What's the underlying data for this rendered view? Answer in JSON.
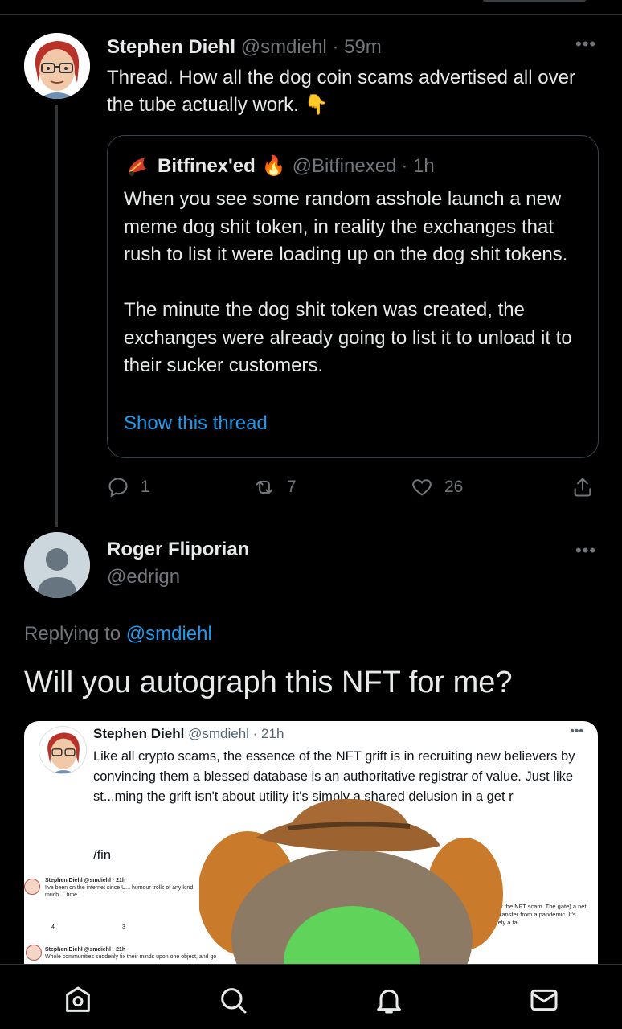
{
  "tweet1": {
    "name": "Stephen Diehl",
    "handle": "@smdiehl",
    "time": "· 59m",
    "text": "Thread. How all the dog coin scams advertised all over the tube actually work. 👇",
    "more_icon": "more-horizontal-icon"
  },
  "quote": {
    "name": "Bitfinex'ed",
    "badge": "🔥",
    "handle": "@Bitfinexed",
    "time": "· 1h",
    "text": "When you see some random asshole launch a new meme dog shit token, in reality the exchanges that rush to list it were loading up on the dog shit tokens.\n\nThe minute the dog shit token was created, the exchanges were already going to list it to unload it to their sucker customers.",
    "show_thread": "Show this thread"
  },
  "actions": {
    "replies": "1",
    "retweets": "7",
    "likes": "26"
  },
  "tweet2": {
    "name": "Roger Fliporian",
    "handle": "@edrign",
    "replying_prefix": "Replying to",
    "replying_mention": "@smdiehl",
    "text": "Will you autograph this NFT for me?"
  },
  "media": {
    "name": "Stephen Diehl",
    "handle": "@smdiehl · 21h",
    "text": "Like all crypto scams, the essence of the NFT grift is in recruiting new believers by convincing them a blessed database is an authoritative registrar of value. Just like st...ming the grift isn't about utility it's simply a shared delusion in a get r",
    "fin": "/fin",
    "mini1_header": "Stephen Diehl @smdiehl · 21h",
    "mini1_text": "I've been on the internet since U... humour trolls of any kind, much ... time.",
    "mini1_replies": "4",
    "mini1_retweets": "3",
    "mini2_header": "Stephen Diehl @smdiehl · 21h",
    "mini2_text": "Whole communities suddenly fix their minds upon one object, and go",
    "right_text": "nature of the NFT scam. The gate) a net wealth transfer from a pandemic. It's effectively a ta"
  },
  "nav": {
    "items": [
      "home-icon",
      "search-icon",
      "notifications-icon",
      "messages-icon"
    ]
  },
  "colors": {
    "background": "#000000",
    "text": "#e7e9ea",
    "muted": "#71767b",
    "link": "#1d9bf0",
    "border": "#38444d"
  }
}
